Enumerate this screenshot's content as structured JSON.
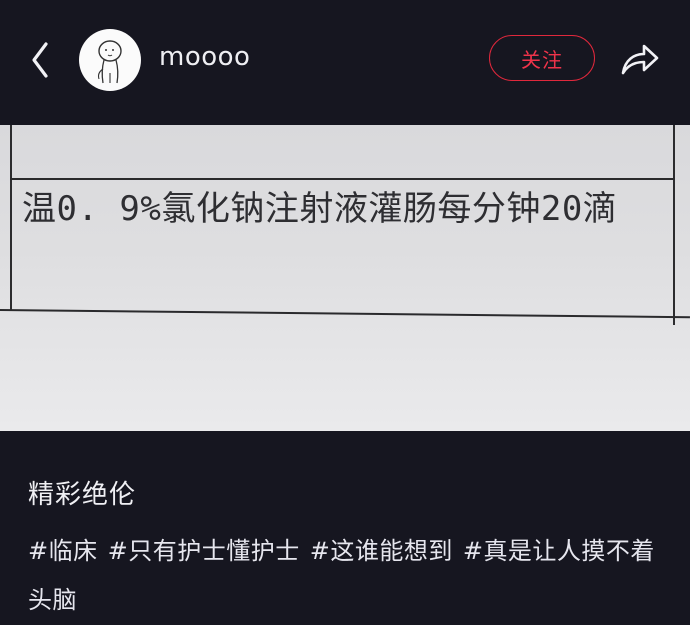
{
  "header": {
    "back_icon": "chevron-left-icon",
    "username": "moooo",
    "follow_label": "关注",
    "share_icon": "share-arrow-icon",
    "follow_color": "#e0283c"
  },
  "photo": {
    "text": "温0. 9%氯化钠注射液灌肠每分钟20滴"
  },
  "post": {
    "title": "精彩绝伦",
    "tags": [
      "#临床",
      "#只有护士懂护士",
      "#这谁能想到",
      "#真是让人摸不着头脑"
    ]
  }
}
